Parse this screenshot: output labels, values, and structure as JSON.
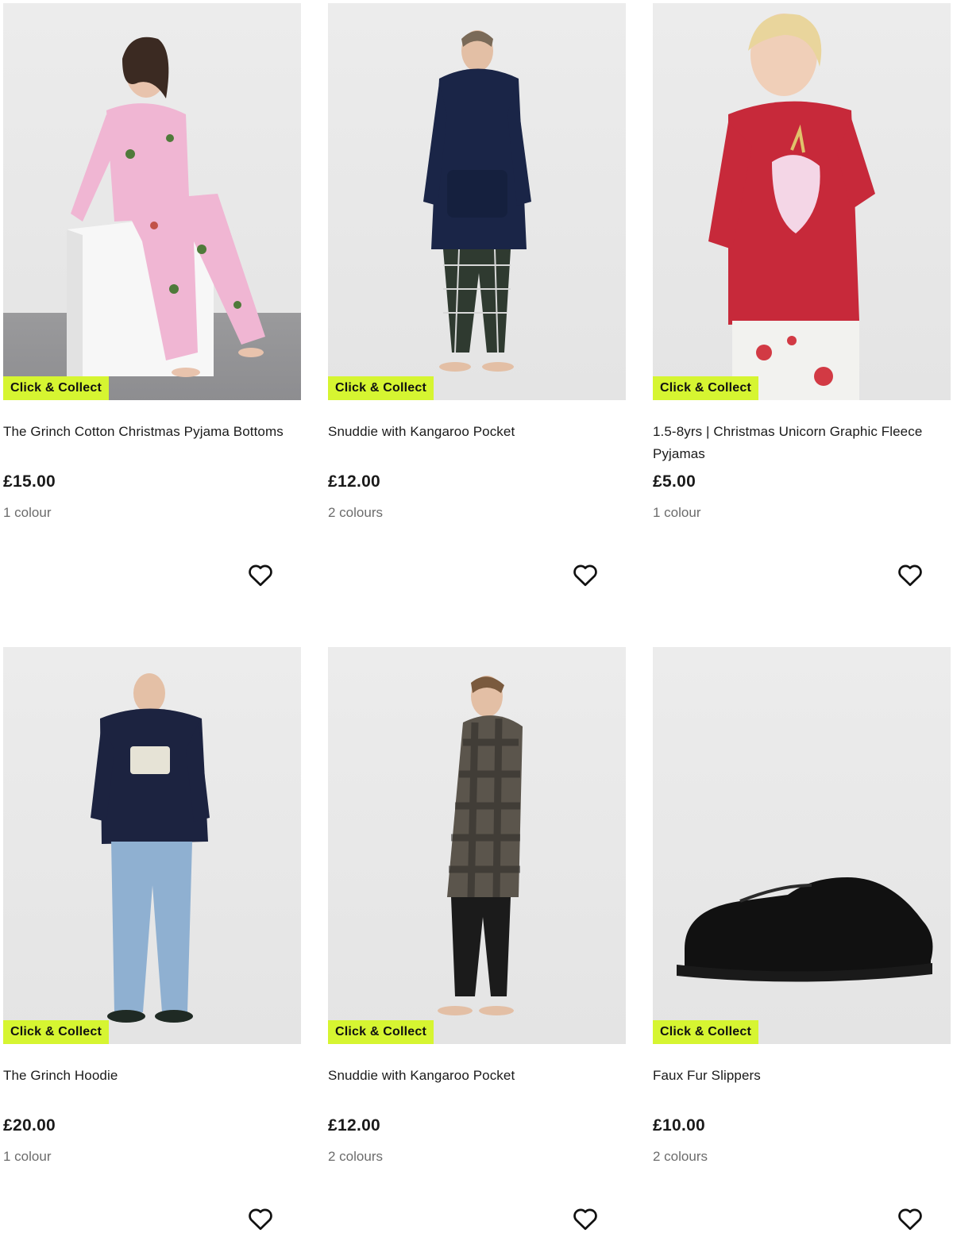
{
  "products": [
    {
      "badge": "Click & Collect",
      "name": "The Grinch Cotton Christmas Pyjama Bottoms",
      "price": "£15.00",
      "colours": "1 colour"
    },
    {
      "badge": "Click & Collect",
      "name": "Snuddie with Kangaroo Pocket",
      "price": "£12.00",
      "colours": "2 colours"
    },
    {
      "badge": "Click & Collect",
      "name": "1.5-8yrs | Christmas Unicorn Graphic Fleece Pyjamas",
      "price": "£5.00",
      "colours": "1 colour"
    },
    {
      "badge": "Click & Collect",
      "name": "The Grinch Hoodie",
      "price": "£20.00",
      "colours": "1 colour"
    },
    {
      "badge": "Click & Collect",
      "name": "Snuddie with Kangaroo Pocket",
      "price": "£12.00",
      "colours": "2 colours"
    },
    {
      "badge": "Click & Collect",
      "name": "Faux Fur Slippers",
      "price": "£10.00",
      "colours": "2 colours"
    }
  ],
  "colors": {
    "badge_bg": "#d6f531",
    "text": "#1a1a1a",
    "muted": "#6c6c6c"
  },
  "icons": {
    "wishlist": "heart-outline-icon"
  }
}
